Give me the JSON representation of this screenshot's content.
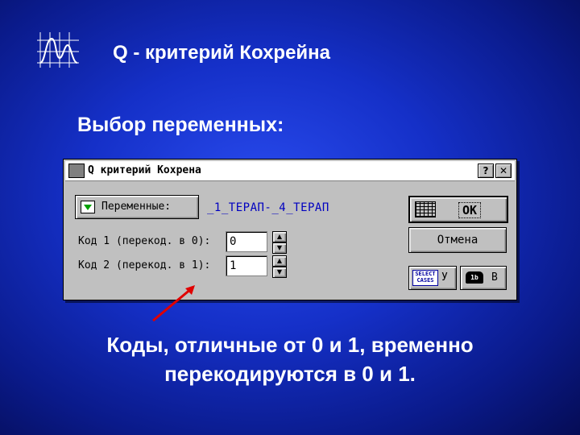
{
  "slide": {
    "title": "Q - критерий Кохрейна",
    "subtitle": "Выбор переменных:",
    "caption_line1": "Коды, отличные от 0 и 1, временно",
    "caption_line2": "перекодируются в 0 и 1."
  },
  "dialog": {
    "title": "Q критерий Кохрена",
    "help_button": "?",
    "close_button": "✕",
    "variables_button": "Переменные:",
    "variables_value": "_1_ТЕРАП-_4_ТЕРАП",
    "code1_label": "Код 1 (перекод. в 0):",
    "code1_value": "0",
    "code2_label": "Код 2 (перекод. в 1):",
    "code2_value": "1",
    "ok_button": "OK",
    "cancel_button": "Отмена",
    "select_cases_text": "SELECT CASES",
    "select_cases_key": "У",
    "weight_icon_text": "1b",
    "weight_key": "В"
  },
  "colors": {
    "background": "#1530c8",
    "dialog_face": "#c0c0c0",
    "variables_value": "#0000c0",
    "annotation_arrow": "#e00000"
  },
  "icons": [
    "graph-logo-icon",
    "app-icon",
    "variables-icon",
    "spreadsheet-icon",
    "select-cases-icon",
    "weight-icon",
    "spin-up-icon",
    "spin-down-icon"
  ]
}
